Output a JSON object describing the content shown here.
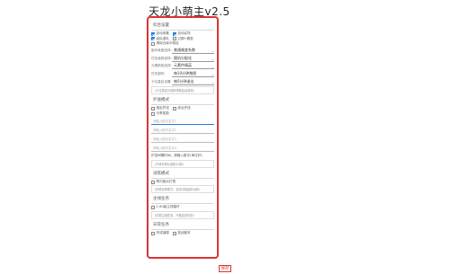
{
  "app": {
    "title": "天龙小萌主v2.5"
  },
  "general": {
    "title": "综合设置",
    "checkboxes_row1": [
      {
        "label": "自动采集",
        "checked": true
      },
      {
        "label": "自动买符",
        "checked": true
      }
    ],
    "checkboxes_row2": [
      {
        "label": "组队退队",
        "checked": true
      },
      {
        "label": "过期+跟查",
        "checked": false
      }
    ],
    "checkbox_row3": {
      "label": "清除仓库中物品",
      "checked": false
    },
    "selects": [
      {
        "label": "副本难度选择:",
        "value": "普通难度系数"
      },
      {
        "label": "任务道具选择:",
        "value": "随机分配化"
      },
      {
        "label": "元素精英选择:",
        "value": "元素件精英"
      },
      {
        "label": "任务超时:",
        "value": "每10分钟跑图"
      },
      {
        "label": "卡住重启设置:",
        "value": "每5分钟退出"
      }
    ],
    "note": "（卡住重启可选择重新启动游戏）"
  },
  "escort": {
    "title": "护送模式",
    "checkboxes_row1": [
      {
        "label": "指定护送",
        "checked": false
      },
      {
        "label": "综合护送",
        "checked": false
      }
    ],
    "checkbox_row2": {
      "label": "分享奖励",
      "checked": false
    },
    "inputs": [
      {
        "placeholder": "请输入精灵名字1",
        "focus": true
      },
      {
        "placeholder": "请输入精灵名字2",
        "focus": false
      },
      {
        "placeholder": "请输入精灵名字3",
        "focus": false
      },
      {
        "placeholder": "请输入精灵名字4",
        "focus": false
      }
    ],
    "note_label": "护送间隔时间，请输入数字(单位秒)",
    "note": "（不填写默认使用10秒）"
  },
  "trial": {
    "title": "试炼模式",
    "checkbox": {
      "label": "帮内指派打怪",
      "checked": false
    },
    "note": "（仅限试炼模式，自动寻找副本目标）"
  },
  "main_task": {
    "title": "主线任务",
    "checkbox": {
      "label": "1-60级主线循环",
      "checked": false
    },
    "note": "（仅限主线任务，不做支线任务）"
  },
  "daily": {
    "title": "日常任务",
    "checkboxes": [
      {
        "label": "完成酒肆",
        "checked": false
      },
      {
        "label": "挑战副本",
        "checked": false
      }
    ]
  },
  "save": {
    "label": "保存"
  }
}
